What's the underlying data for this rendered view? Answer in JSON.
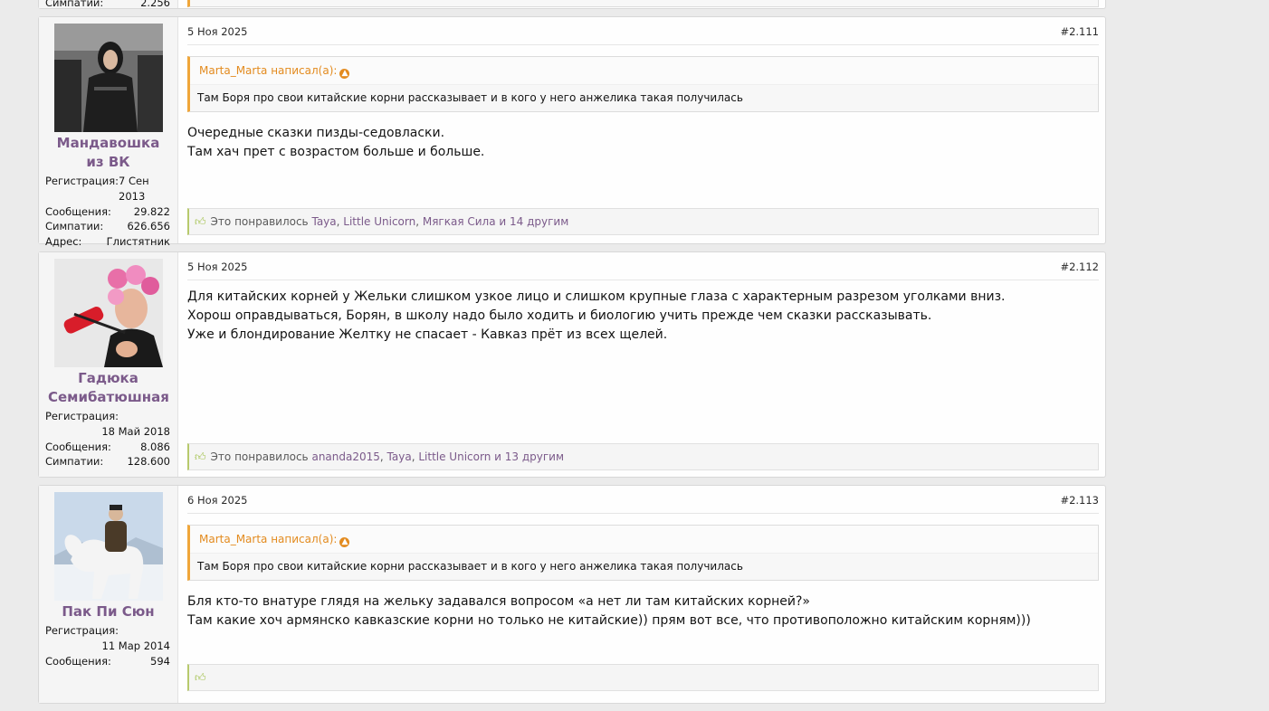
{
  "prev_post": {
    "stat_key": "Симпатии:",
    "stat_val": "2.256"
  },
  "posts": [
    {
      "author": "Мандавошка из ВК",
      "date": "5 Ноя 2025",
      "number": "#2.111",
      "stats": {
        "reg_key": "Регистрация:",
        "reg_val": "7 Сен 2013",
        "msg_key": "Сообщения:",
        "msg_val": "29.822",
        "sym_key": "Симпатии:",
        "sym_val": "626.656",
        "addr_key": "Адрес:",
        "addr_val": "Глистятник"
      },
      "quote": {
        "author_line": "Marta_Marta написал(а):",
        "text": "Там Боря про свои китайские корни рассказывает и в кого у него анжелика такая получилась"
      },
      "lines": [
        "Очередные сказки пизды-седовласки.",
        "Там хач прет с возрастом больше и больше."
      ],
      "likes": {
        "prefix": "Это понравилось",
        "users": [
          "Taya",
          "Little Unicorn",
          "Мягкая Сила"
        ],
        "suffix": "и 14 другим"
      }
    },
    {
      "author": "Гадюка Семибатюшная",
      "date": "5 Ноя 2025",
      "number": "#2.112",
      "stats": {
        "reg_key": "Регистрация:",
        "reg_val": "18 Май 2018",
        "msg_key": "Сообщения:",
        "msg_val": "8.086",
        "sym_key": "Симпатии:",
        "sym_val": "128.600"
      },
      "lines": [
        "Для китайских корней у Жельки слишком узкое лицо и слишком крупные глаза с характерным разрезом уголками вниз.",
        "Хорош оправдываться, Борян, в школу надо было ходить и биологию учить прежде чем сказки рассказывать.",
        "Уже и блондирование Желтку не спасает - Кавказ прёт из всех щелей."
      ],
      "likes": {
        "prefix": "Это понравилось",
        "users": [
          "ananda2015",
          "Taya",
          "Little Unicorn"
        ],
        "suffix": "и 13 другим"
      }
    },
    {
      "author": "Пак Пи Сюн",
      "date": "6 Ноя 2025",
      "number": "#2.113",
      "stats": {
        "reg_key": "Регистрация:",
        "reg_val": "11 Мар 2014",
        "msg_key": "Сообщения:",
        "msg_val": "594"
      },
      "quote": {
        "author_line": "Marta_Marta написал(а):",
        "text": "Там Боря про свои китайские корни рассказывает и в кого у него анжелика такая получилась"
      },
      "lines": [
        "Бля кто-то внатуре глядя на жельку задавался вопросом «а нет ли там китайских корней?»",
        "Там какие хоч армянско кавказские корни но только не китайские)) прям вот все, что противоположно китайским корням)))"
      ]
    }
  ]
}
